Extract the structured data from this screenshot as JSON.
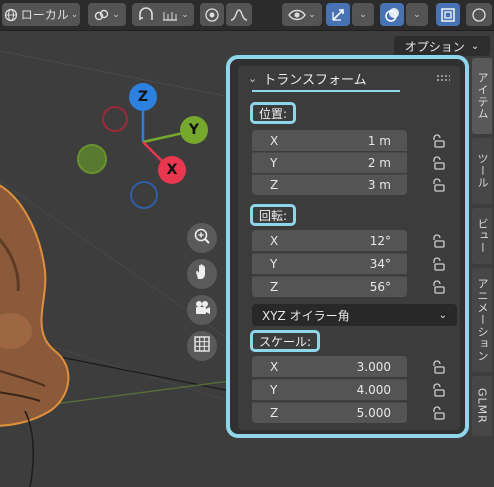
{
  "header": {
    "orientation_label": "ローカル",
    "icons": [
      "globe-icon",
      "link-icon",
      "snap-icon",
      "proportional-icon",
      "falloff-icon",
      "eye-icon",
      "gizmo-icon",
      "overlay-icon",
      "xray-icon"
    ]
  },
  "viewport": {
    "options_label": "オプション",
    "gizmo": {
      "z": "Z",
      "y": "Y",
      "x": "X"
    },
    "nav_icons": [
      "zoom-icon",
      "hand-icon",
      "camera-icon",
      "grid-icon"
    ]
  },
  "panel": {
    "title": "トランスフォーム",
    "location": {
      "label": "位置:",
      "fields": [
        {
          "axis": "X",
          "value": "1 m"
        },
        {
          "axis": "Y",
          "value": "2 m"
        },
        {
          "axis": "Z",
          "value": "3 m"
        }
      ]
    },
    "rotation": {
      "label": "回転:",
      "fields": [
        {
          "axis": "X",
          "value": "12°"
        },
        {
          "axis": "Y",
          "value": "34°"
        },
        {
          "axis": "Z",
          "value": "56°"
        }
      ],
      "mode": "XYZ オイラー角"
    },
    "scale": {
      "label": "スケール:",
      "fields": [
        {
          "axis": "X",
          "value": "3.000"
        },
        {
          "axis": "Y",
          "value": "4.000"
        },
        {
          "axis": "Z",
          "value": "5.000"
        }
      ]
    }
  },
  "tabs": [
    "アイテム",
    "ツール",
    "ビュー",
    "アニメーション",
    "GLMR"
  ],
  "colors": {
    "highlight": "#8fd6ea",
    "axis_x": "#e8374f",
    "axis_y": "#76a82d",
    "axis_z": "#2b80e0",
    "active_button": "#4772b3"
  }
}
